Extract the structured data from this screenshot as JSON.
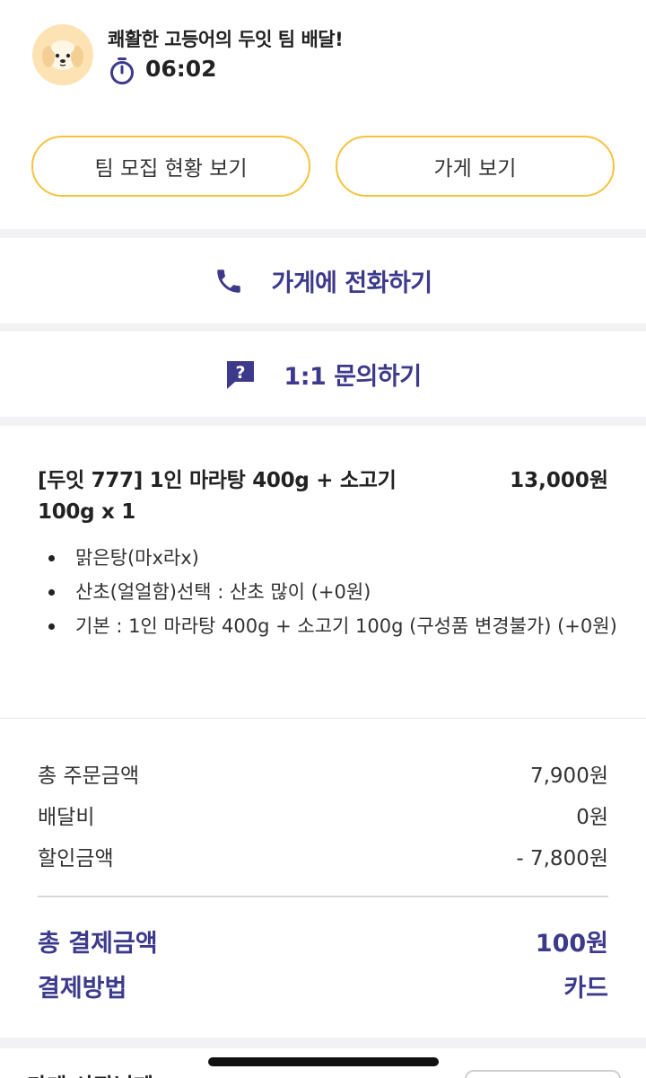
{
  "header": {
    "team_title": "쾌활한 고등어의 두잇 팀 배달!",
    "timer": "06:02"
  },
  "buttons": {
    "recruit_status": "팀 모집 현황 보기",
    "view_store": "가게 보기"
  },
  "actions": {
    "call_store": "가게에 전화하기",
    "inquiry": "1:1 문의하기"
  },
  "order_item": {
    "name": "[두잇 777] 1인 마라탕 400g + 소고기 100g x 1",
    "price": "13,000원",
    "options": [
      "맑은탕(마x라x)",
      "산초(얼얼함)선택 : 산초 많이 (+0원)",
      "기본 : 1인 마라탕 400g + 소고기 100g (구성품 변경불가) (+0원)"
    ]
  },
  "summary": {
    "order_total_label": "총 주문금액",
    "order_total_value": "7,900원",
    "delivery_label": "배달비",
    "delivery_value": "0원",
    "discount_label": "할인금액",
    "discount_value": "- 7,800원",
    "payment_total_label": "총 결제금액",
    "payment_total_value": "100원",
    "payment_method_label": "결제방법",
    "payment_method_value": "카드"
  },
  "bottom": {
    "cut_off_heading": "가게 사장님께"
  },
  "colors": {
    "accent_purple": "#3d3a8c",
    "pill_border_yellow": "#f7c23d",
    "section_gray": "#f2f2f4",
    "avatar_bg": "#fde3b4"
  },
  "icons": {
    "avatar": "puppy-avatar-icon",
    "timer": "stopwatch-icon",
    "call": "phone-icon",
    "inquiry": "question-bubble-icon"
  }
}
